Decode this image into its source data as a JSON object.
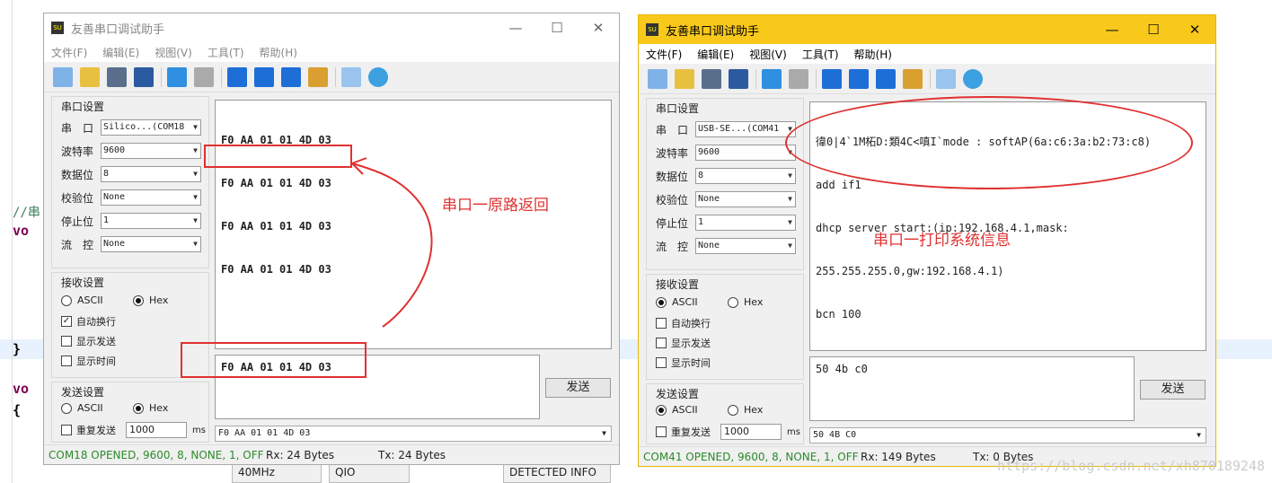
{
  "background": {
    "code_lines": [
      "vo",
      "}",
      "vo",
      "{"
    ],
    "comment": "//串"
  },
  "left_window": {
    "title": "友善串口调试助手",
    "menu": [
      "文件(F)",
      "编辑(E)",
      "视图(V)",
      "工具(T)",
      "帮助(H)"
    ],
    "serial_settings_title": "串口设置",
    "fields": [
      {
        "label": "串　口",
        "value": "Silico...(COM18"
      },
      {
        "label": "波特率",
        "value": "9600"
      },
      {
        "label": "数据位",
        "value": "8"
      },
      {
        "label": "校验位",
        "value": "None"
      },
      {
        "label": "停止位",
        "value": "1"
      },
      {
        "label": "流　控",
        "value": "None"
      }
    ],
    "receive_settings_title": "接收设置",
    "recv_ascii": "ASCII",
    "recv_hex": "Hex",
    "auto_wrap": "自动换行",
    "show_send": "显示发送",
    "show_time": "显示时间",
    "send_settings_title": "发送设置",
    "send_ascii": "ASCII",
    "send_hex": "Hex",
    "repeat_send": "重复发送",
    "repeat_value": "1000",
    "ms": "ms",
    "received_lines": [
      "F0 AA 01 01 4D 03",
      "F0 AA 01 01 4D 03",
      "F0 AA 01 01 4D 03",
      "F0 AA 01 01 4D 03"
    ],
    "send_text": "F0 AA 01 01 4D 03",
    "send_button": "发送",
    "history_value": "F0 AA 01 01 4D 03",
    "status_port": "COM18 OPENED, 9600, 8, NONE, 1, OFF",
    "status_rx": "Rx: 24 Bytes",
    "status_tx": "Tx: 24 Bytes"
  },
  "right_window": {
    "title": "友善串口调试助手",
    "menu": [
      "文件(F)",
      "编辑(E)",
      "视图(V)",
      "工具(T)",
      "帮助(H)"
    ],
    "serial_settings_title": "串口设置",
    "fields": [
      {
        "label": "串　口",
        "value": "USB-SE...(COM41"
      },
      {
        "label": "波特率",
        "value": "9600"
      },
      {
        "label": "数据位",
        "value": "8"
      },
      {
        "label": "校验位",
        "value": "None"
      },
      {
        "label": "停止位",
        "value": "1"
      },
      {
        "label": "流　控",
        "value": "None"
      }
    ],
    "receive_settings_title": "接收设置",
    "recv_ascii": "ASCII",
    "recv_hex": "Hex",
    "auto_wrap": "自动换行",
    "show_send": "显示发送",
    "show_time": "显示时间",
    "send_settings_title": "发送设置",
    "send_ascii": "ASCII",
    "send_hex": "Hex",
    "repeat_send": "重复发送",
    "repeat_value": "1000",
    "ms": "ms",
    "received_lines": [
      "徫0|4`1M柘D:類4C<嗔I`mode : softAP(6a:c6:3a:b2:73:c8)",
      "add if1",
      "dhcp server start:(ip:192.168.4.1,mask:",
      "255.255.255.0,gw:192.168.4.1)",
      "bcn 100"
    ],
    "send_text": "50 4b c0",
    "send_button": "发送",
    "history_value": "50 4B C0",
    "status_port": "COM41 OPENED, 9600, 8, NONE, 1, OFF",
    "status_rx": "Rx: 149 Bytes",
    "status_tx": "Tx: 0 Bytes"
  },
  "annotations": {
    "left": "串口一原路返回",
    "right": "串口一打印系统信息"
  },
  "under": {
    "freq": "40MHz",
    "qio": "QIO",
    "detected": "DETECTED INFO"
  },
  "watermark": "https://blog.csdn.net/xh870189248"
}
